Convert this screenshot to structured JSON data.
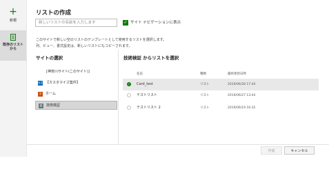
{
  "rail": {
    "new_label": "新規",
    "existing_label_line1": "既存のリスト",
    "existing_label_line2": "から"
  },
  "dialog": {
    "title": "リストの作成",
    "name_placeholder": "新しいリストの名前を入力します",
    "nav_label": "サイト ナビゲーションに表示",
    "nav_checked": true,
    "desc_line1": "このサイトで新しい空のリストのテンプレートとして使用するリストを選択します。",
    "desc_line2": "列、ビュー、書式設定は、新しいリストにもコピーされます。"
  },
  "sites": {
    "title": "サイトの選択",
    "items": [
      {
        "label": "[神奈川サイト(このサイト)]",
        "icon": "none",
        "selected": false
      },
      {
        "label": "【カスタマイズ案件】",
        "icon": "site-icon-blue",
        "abbr": "カス",
        "color": "#0f6cbd",
        "selected": false
      },
      {
        "label": "ホーム",
        "icon": "site-icon-orange",
        "abbr": "ホ",
        "color": "#ca5010",
        "selected": false
      },
      {
        "label": "技術検証",
        "icon": "site-icon-gray",
        "abbr": "技",
        "color": "#69797e",
        "selected": true
      }
    ]
  },
  "lists": {
    "title": "技術検証 からリストを選択",
    "columns": {
      "name": "名前",
      "type": "種類",
      "modified": "最終更新日時"
    },
    "rows": [
      {
        "name": "Card_test",
        "type": "リスト",
        "modified": "2019/06/28 17:44",
        "selected": true
      },
      {
        "name": "テストリスト",
        "type": "リスト",
        "modified": "2019/06/27 13:44",
        "selected": false
      },
      {
        "name": "テストリスト 2",
        "type": "リスト",
        "modified": "2019/06/19 16:32",
        "selected": false
      }
    ]
  },
  "buttons": {
    "create": "作成",
    "cancel": "キャンセル"
  },
  "colors": {
    "accent": "#107c10"
  }
}
